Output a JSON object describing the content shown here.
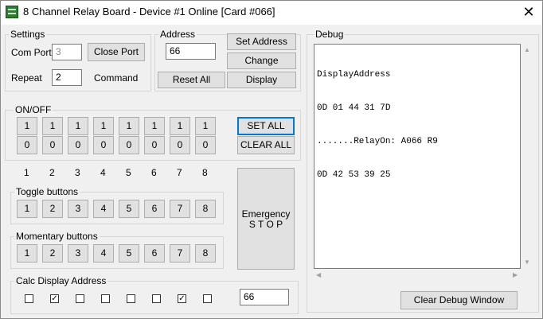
{
  "window": {
    "title": "8 Channel Relay Board - Device #1 Online [Card #066]",
    "close_glyph": "✕"
  },
  "settings": {
    "group_label": "Settings",
    "com_port_label": "Com Port",
    "com_port_value": "3",
    "close_port_label": "Close Port",
    "repeat_label": "Repeat",
    "repeat_value": "2",
    "command_label": "Command"
  },
  "address": {
    "group_label": "Address",
    "value": "66",
    "set_address": "Set Address",
    "change": "Change",
    "reset_all": "Reset All",
    "display": "Display"
  },
  "onoff": {
    "group_label": "ON/OFF",
    "on_labels": [
      "1",
      "1",
      "1",
      "1",
      "1",
      "1",
      "1",
      "1"
    ],
    "off_labels": [
      "0",
      "0",
      "0",
      "0",
      "0",
      "0",
      "0",
      "0"
    ],
    "set_all": "SET ALL",
    "clear_all": "CLEAR ALL"
  },
  "channel_numbers": [
    "1",
    "2",
    "3",
    "4",
    "5",
    "6",
    "7",
    "8"
  ],
  "toggle": {
    "group_label": "Toggle buttons",
    "labels": [
      "1",
      "2",
      "3",
      "4",
      "5",
      "6",
      "7",
      "8"
    ]
  },
  "momentary": {
    "group_label": "Momentary buttons",
    "labels": [
      "1",
      "2",
      "3",
      "4",
      "5",
      "6",
      "7",
      "8"
    ]
  },
  "emergency": {
    "line1": "Emergency",
    "line2": "S T O P"
  },
  "calc": {
    "group_label": "Calc Display Address",
    "checkboxes": [
      false,
      true,
      false,
      false,
      false,
      false,
      true,
      false
    ],
    "value": "66"
  },
  "debug": {
    "group_label": "Debug",
    "lines": [
      "DisplayAddress",
      "0D 01 44 31 7D",
      ".......RelayOn: A066 R9",
      "0D 42 53 39 25"
    ],
    "clear_button": "Clear Debug Window"
  }
}
